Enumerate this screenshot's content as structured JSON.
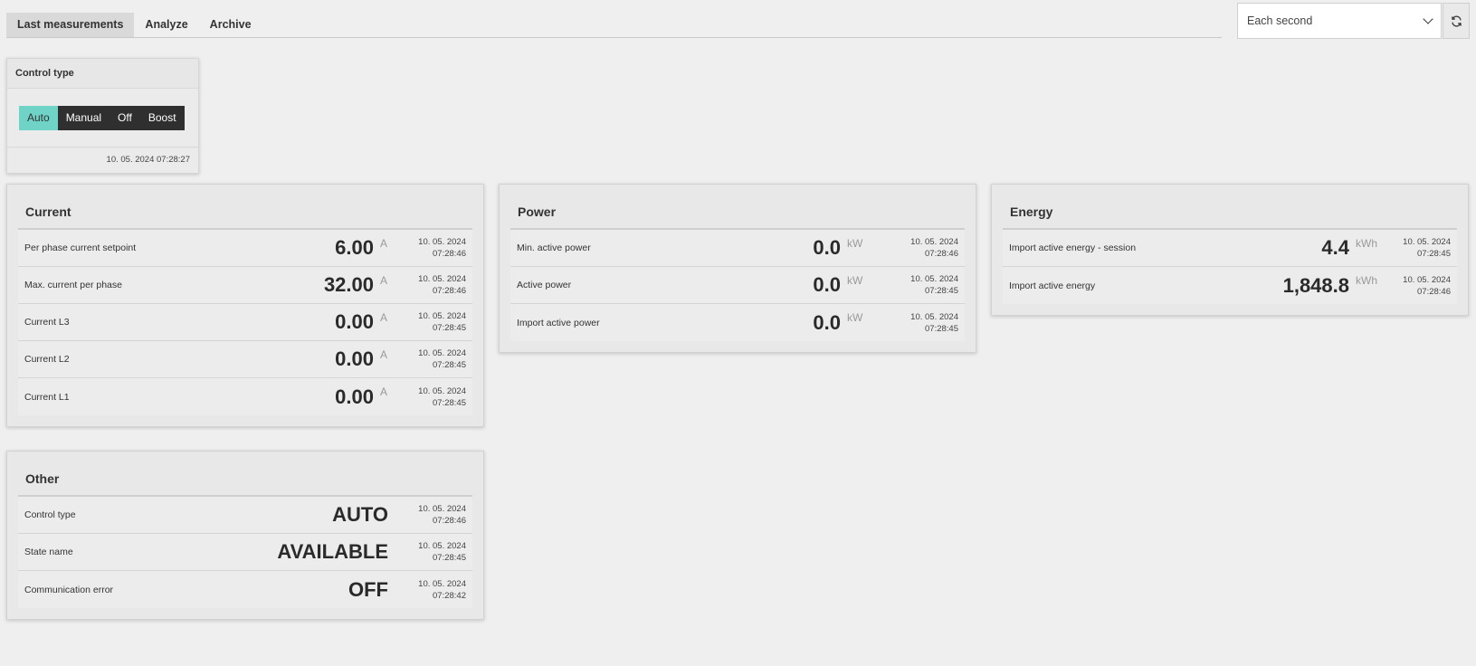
{
  "tabs": [
    {
      "label": "Last measurements",
      "active": true
    },
    {
      "label": "Analyze",
      "active": false
    },
    {
      "label": "Archive",
      "active": false
    }
  ],
  "interval": {
    "value": "Each second",
    "icon": "chevron-down-icon",
    "refresh_icon": "refresh-icon"
  },
  "control_type": {
    "title": "Control type",
    "options": [
      {
        "label": "Auto",
        "active": true
      },
      {
        "label": "Manual",
        "active": false
      },
      {
        "label": "Off",
        "active": false
      },
      {
        "label": "Boost",
        "active": false
      }
    ],
    "timestamp": "10. 05. 2024 07:28:27"
  },
  "current": {
    "title": "Current",
    "rows": [
      {
        "label": "Per phase current setpoint",
        "value": "6.00",
        "unit": "A",
        "date": "10. 05. 2024",
        "time": "07:28:46"
      },
      {
        "label": "Max. current per phase",
        "value": "32.00",
        "unit": "A",
        "date": "10. 05. 2024",
        "time": "07:28:46"
      },
      {
        "label": "Current L3",
        "value": "0.00",
        "unit": "A",
        "date": "10. 05. 2024",
        "time": "07:28:45"
      },
      {
        "label": "Current L2",
        "value": "0.00",
        "unit": "A",
        "date": "10. 05. 2024",
        "time": "07:28:45"
      },
      {
        "label": "Current L1",
        "value": "0.00",
        "unit": "A",
        "date": "10. 05. 2024",
        "time": "07:28:45"
      }
    ]
  },
  "power": {
    "title": "Power",
    "rows": [
      {
        "label": "Min. active power",
        "value": "0.0",
        "unit": "kW",
        "date": "10. 05. 2024",
        "time": "07:28:46"
      },
      {
        "label": "Active power",
        "value": "0.0",
        "unit": "kW",
        "date": "10. 05. 2024",
        "time": "07:28:45"
      },
      {
        "label": "Import active power",
        "value": "0.0",
        "unit": "kW",
        "date": "10. 05. 2024",
        "time": "07:28:45"
      }
    ]
  },
  "energy": {
    "title": "Energy",
    "rows": [
      {
        "label": "Import active energy - session",
        "value": "4.4",
        "unit": "kWh",
        "date": "10. 05. 2024",
        "time": "07:28:45"
      },
      {
        "label": "Import active energy",
        "value": "1,848.8",
        "unit": "kWh",
        "date": "10. 05. 2024",
        "time": "07:28:46"
      }
    ]
  },
  "other": {
    "title": "Other",
    "rows": [
      {
        "label": "Control type",
        "value": "AUTO",
        "date": "10. 05. 2024",
        "time": "07:28:46"
      },
      {
        "label": "State name",
        "value": "AVAILABLE",
        "date": "10. 05. 2024",
        "time": "07:28:45"
      },
      {
        "label": "Communication error",
        "value": "OFF",
        "date": "10. 05. 2024",
        "time": "07:28:42"
      }
    ]
  }
}
